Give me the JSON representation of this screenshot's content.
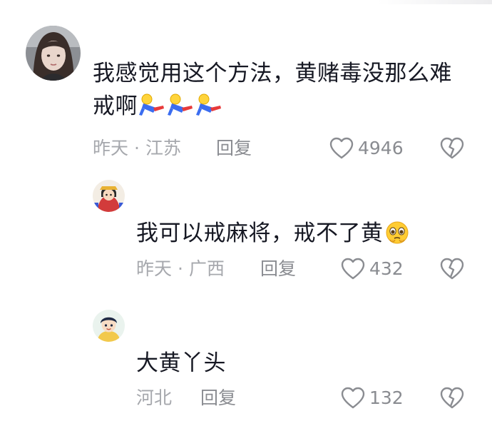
{
  "comments": [
    {
      "avatar": "woman-portrait-avatar",
      "text_line1": "我感觉用这个方法，黄赌毒没那么难",
      "text_line2": "戒啊",
      "emoji": [
        "running-figure-emoji",
        "running-figure-emoji",
        "running-figure-emoji"
      ],
      "time": "昨天",
      "separator": "·",
      "location": "江苏",
      "reply_label": "回复",
      "likes": "4946",
      "like_icon": "heart-outline-icon",
      "dislike_icon": "broken-heart-icon"
    },
    {
      "avatar": "anime-character-avatar",
      "text": "我可以戒麻将，戒不了黄",
      "emoji": "pleading-face-emoji",
      "time": "昨天",
      "separator": "·",
      "location": "广西",
      "reply_label": "回复",
      "likes": "432",
      "like_icon": "heart-outline-icon",
      "dislike_icon": "broken-heart-icon"
    },
    {
      "avatar": "cartoon-boy-avatar",
      "text": "大黄丫头",
      "location": "河北",
      "reply_label": "回复",
      "likes": "132",
      "like_icon": "heart-outline-icon",
      "dislike_icon": "broken-heart-icon"
    }
  ],
  "colors": {
    "text_primary": "#161823",
    "text_meta": "#a6a8ad",
    "icon_gray": "#8a8c91"
  }
}
